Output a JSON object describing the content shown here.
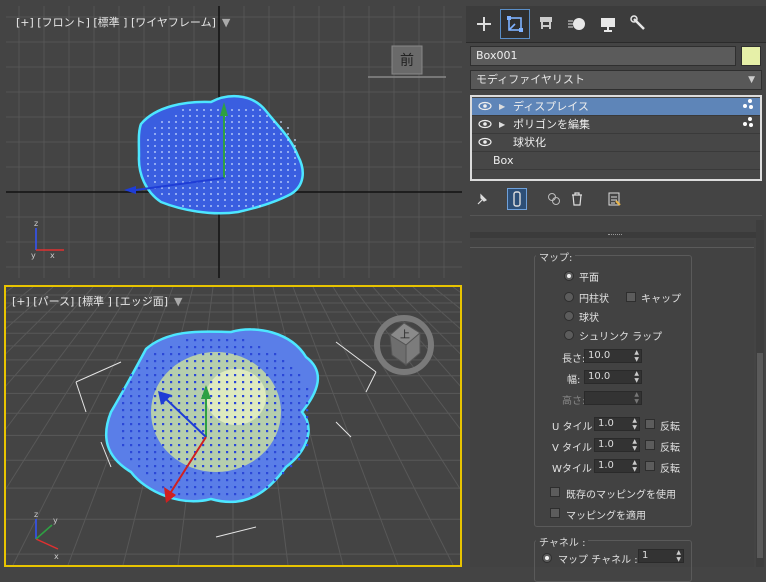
{
  "viewports": {
    "front": {
      "label": "[+] [フロント] [標準 ] [ワイヤフレーム]"
    },
    "perspective": {
      "label": "[+] [パース] [標準 ] [エッジ面]"
    },
    "viewcube_front_label": "前",
    "viewcube_top_label": "上",
    "axis_x": "x",
    "axis_y": "y",
    "axis_z": "z"
  },
  "command_panel": {
    "tabs": [
      "create-icon",
      "modify-icon",
      "hierarchy-icon",
      "motion-icon",
      "display-icon",
      "utilities-icon"
    ],
    "active_tab": "modify",
    "object_name": "Box001",
    "object_color": "#e6f0a8",
    "modifier_list_label": "モディファイヤリスト",
    "modifier_stack": [
      {
        "label": "ディスプレイス",
        "selected": true,
        "has_subobject": true
      },
      {
        "label": "ポリゴンを編集",
        "selected": false,
        "has_subobject": true
      },
      {
        "label": "球状化",
        "selected": false,
        "has_subobject": false
      },
      {
        "label": "Box",
        "selected": false,
        "has_subobject": false
      }
    ]
  },
  "map_group": {
    "title": "マップ:",
    "options": {
      "planar": "平面",
      "cylindrical": "円柱状",
      "cap": "キャップ",
      "spherical": "球状",
      "shrinkwrap": "シュリンク ラップ"
    },
    "selected": "planar",
    "length_label": "長さ:",
    "length_value": "10.0",
    "width_label": "幅:",
    "width_value": "10.0",
    "height_label": "高さ:",
    "height_value": "",
    "u_tile_label": "U タイル :",
    "u_tile_value": "1.0",
    "v_tile_label": "V タイル :",
    "v_tile_value": "1.0",
    "w_tile_label": "Wタイル :",
    "w_tile_value": "1.0",
    "flip_label": "反転",
    "use_existing_label": "既存のマッピングを使用",
    "apply_mapping_label": "マッピングを適用"
  },
  "channel_group": {
    "title": "チャネル :",
    "map_channel_label": "マップ チャネル :",
    "map_channel_value": "1"
  },
  "colors": {
    "selection_blue": "#5e85b8",
    "wire_cyan": "#4de6ff",
    "mesh_blue": "#3a5ee0",
    "viewport_bg": "#444444"
  }
}
